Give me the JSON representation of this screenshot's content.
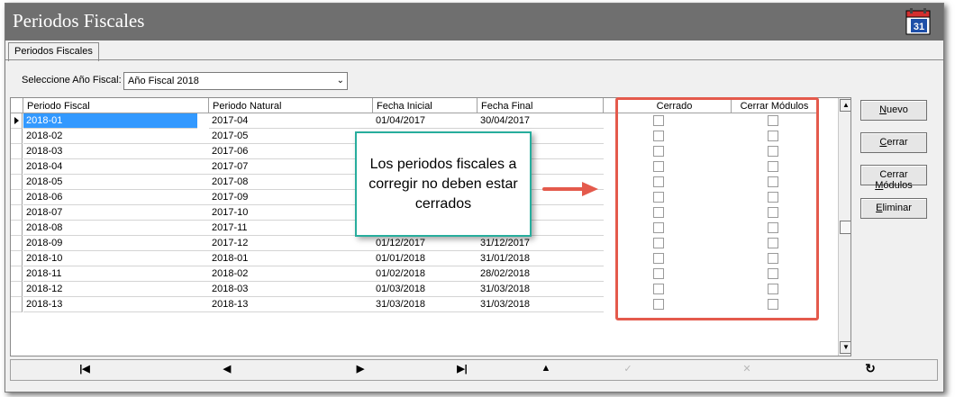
{
  "window": {
    "title": "Periodos Fiscales",
    "icon": "calendar-31-icon",
    "calendar_day": "31"
  },
  "tabs": [
    {
      "label": "Periodos Fiscales"
    }
  ],
  "fiscal_year": {
    "label": "Seleccione Año Fiscal:",
    "value": "Año Fiscal 2018"
  },
  "grid": {
    "columns": [
      "Periodo Fiscal",
      "Periodo Natural",
      "Fecha Inicial",
      "Fecha Final",
      "Cerrado",
      "Cerrar Módulos"
    ],
    "rows": [
      {
        "fiscal": "2018-01",
        "natural": "2017-04",
        "start": "01/04/2017",
        "end": "30/04/2017",
        "cerrado": false,
        "cerrar_modulos": false
      },
      {
        "fiscal": "2018-02",
        "natural": "2017-05",
        "start": "",
        "end": "",
        "cerrado": false,
        "cerrar_modulos": false
      },
      {
        "fiscal": "2018-03",
        "natural": "2017-06",
        "start": "",
        "end": "",
        "cerrado": false,
        "cerrar_modulos": false
      },
      {
        "fiscal": "2018-04",
        "natural": "2017-07",
        "start": "",
        "end": "",
        "cerrado": false,
        "cerrar_modulos": false
      },
      {
        "fiscal": "2018-05",
        "natural": "2017-08",
        "start": "",
        "end": "",
        "cerrado": false,
        "cerrar_modulos": false
      },
      {
        "fiscal": "2018-06",
        "natural": "2017-09",
        "start": "",
        "end": "",
        "cerrado": false,
        "cerrar_modulos": false
      },
      {
        "fiscal": "2018-07",
        "natural": "2017-10",
        "start": "",
        "end": "",
        "cerrado": false,
        "cerrar_modulos": false
      },
      {
        "fiscal": "2018-08",
        "natural": "2017-11",
        "start": "",
        "end": "",
        "cerrado": false,
        "cerrar_modulos": false
      },
      {
        "fiscal": "2018-09",
        "natural": "2017-12",
        "start": "01/12/2017",
        "end": "31/12/2017",
        "cerrado": false,
        "cerrar_modulos": false
      },
      {
        "fiscal": "2018-10",
        "natural": "2018-01",
        "start": "01/01/2018",
        "end": "31/01/2018",
        "cerrado": false,
        "cerrar_modulos": false
      },
      {
        "fiscal": "2018-11",
        "natural": "2018-02",
        "start": "01/02/2018",
        "end": "28/02/2018",
        "cerrado": false,
        "cerrar_modulos": false
      },
      {
        "fiscal": "2018-12",
        "natural": "2018-03",
        "start": "01/03/2018",
        "end": "31/03/2018",
        "cerrado": false,
        "cerrar_modulos": false
      },
      {
        "fiscal": "2018-13",
        "natural": "2018-13",
        "start": "31/03/2018",
        "end": "31/03/2018",
        "cerrado": false,
        "cerrar_modulos": false
      }
    ]
  },
  "callout": {
    "text": "Los periodos fiscales a corregir no deben estar cerrados"
  },
  "buttons": {
    "nuevo": {
      "accel": "N",
      "rest": "uevo"
    },
    "cerrar": {
      "accel": "C",
      "rest": "errar"
    },
    "cerrar_modulos": {
      "pre": "Cerrar ",
      "accel": "M",
      "rest": "ódulos"
    },
    "eliminar": {
      "accel": "E",
      "rest": "liminar"
    }
  },
  "navigator": {
    "first": "|◀",
    "prior": "◀",
    "next": "▶",
    "last": "▶|",
    "insert": "▲",
    "post": "✓",
    "cancel": "✕",
    "refresh": "↻"
  },
  "colors": {
    "titlebar": "#6f6f6f",
    "selection": "#3399ff",
    "highlight_box": "#e45a4c",
    "callout_border": "#27ad9d"
  }
}
